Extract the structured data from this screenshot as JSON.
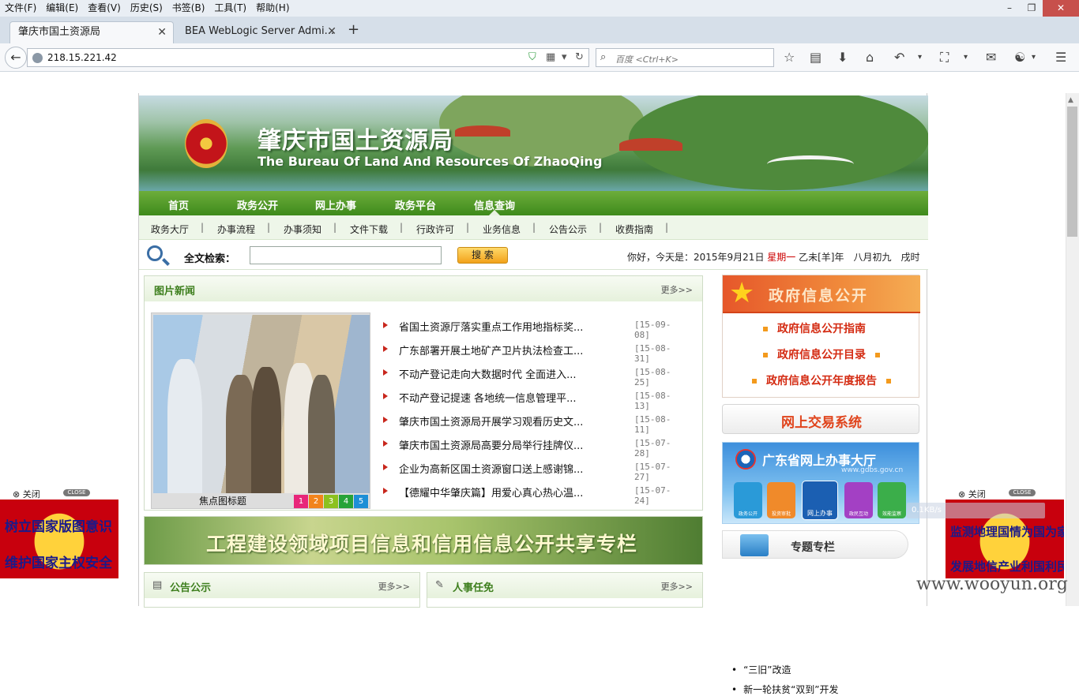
{
  "menubar": {
    "items": [
      "文件(F)",
      "编辑(E)",
      "查看(V)",
      "历史(S)",
      "书签(B)",
      "工具(T)",
      "帮助(H)"
    ],
    "window_buttons": [
      "–",
      "❐",
      "✕"
    ]
  },
  "tabs": [
    {
      "label": "肇庆市国土资源局"
    },
    {
      "label": "BEA WebLogic Server Admi..."
    }
  ],
  "newtab": "+",
  "address": {
    "url": "218.15.221.42"
  },
  "search": {
    "placeholder": "百度 <Ctrl+K>"
  },
  "site": {
    "title_cn": "肇庆市国土资源局",
    "title_en": "The Bureau Of Land And Resources Of ZhaoQing",
    "mainnav": [
      "首页",
      "政务公开",
      "网上办事",
      "政务平台",
      "信息查询"
    ],
    "mainnav_active_index": 4,
    "subnav": [
      "政务大厅",
      "办事流程",
      "办事须知",
      "文件下载",
      "行政许可",
      "业务信息",
      "公告公示",
      "收费指南"
    ],
    "search": {
      "label": "全文检索：",
      "button": "搜 索"
    },
    "date": {
      "prefix": "你好，今天是：2015年9月21日",
      "weekday": "星期一",
      "lunar": "乙未[羊]年　八月初九　戌时"
    },
    "photo_news": {
      "title": "图片新闻",
      "more": "更多>>",
      "photo_caption": "焦点图标题",
      "pager": [
        "1",
        "2",
        "3",
        "4",
        "5"
      ],
      "pager_colors": [
        "#e8267a",
        "#f2841c",
        "#8cc11f",
        "#27a338",
        "#1d8fd6"
      ],
      "items": [
        {
          "title": "省国土资源厅落实重点工作用地指标奖...",
          "date": "[15-09-08]"
        },
        {
          "title": "广东部署开展土地矿产卫片执法检查工...",
          "date": "[15-08-31]"
        },
        {
          "title": "不动产登记走向大数据时代 全面进入...",
          "date": "[15-08-25]"
        },
        {
          "title": "不动产登记提速 各地统一信息管理平...",
          "date": "[15-08-13]"
        },
        {
          "title": "肇庆市国土资源局开展学习观看历史文...",
          "date": "[15-08-11]"
        },
        {
          "title": "肇庆市国土资源局高要分局举行挂牌仪...",
          "date": "[15-07-28]"
        },
        {
          "title": "企业为高新区国土资源窗口送上感谢锦...",
          "date": "[15-07-27]"
        },
        {
          "title": "【德耀中华肇庆篇】用爱心真心热心温...",
          "date": "[15-07-24]"
        }
      ]
    },
    "promo": "工程建设领域项目信息和信用信息公开共享专栏",
    "notice": {
      "title": "公告公示",
      "more": "更多>>"
    },
    "personnel": {
      "title": "人事任免",
      "more": "更多>>"
    },
    "info_public": {
      "title": "政府信息公开",
      "links": [
        "政府信息公开指南",
        "政府信息公开目录",
        "政府信息公开年度报告"
      ]
    },
    "trade": "网上交易系统",
    "gd_hall": {
      "title": "广东省网上办事大厅",
      "url": "www.gdbs.gov.cn",
      "icons": [
        "政务公开",
        "投资审批",
        "网上办事",
        "政民互动",
        "效能监察"
      ]
    },
    "topics": {
      "title": "专题专栏",
      "items": [
        "“三旧”改造",
        "新一轮扶贫“双到”开发"
      ]
    }
  },
  "ads": {
    "left": {
      "close": "⊗ 关闭",
      "badge": "CLOSE",
      "line1": "树立国家版图意识",
      "line2": "维护国家主权安全"
    },
    "right": {
      "close": "⊗ 关闭",
      "badge": "CLOSE",
      "line1": "监测地理国情为国为家",
      "line2": "发展地信产业利国利民"
    }
  },
  "speed": "0.1KB/s",
  "watermark": "www.wooyun.org"
}
